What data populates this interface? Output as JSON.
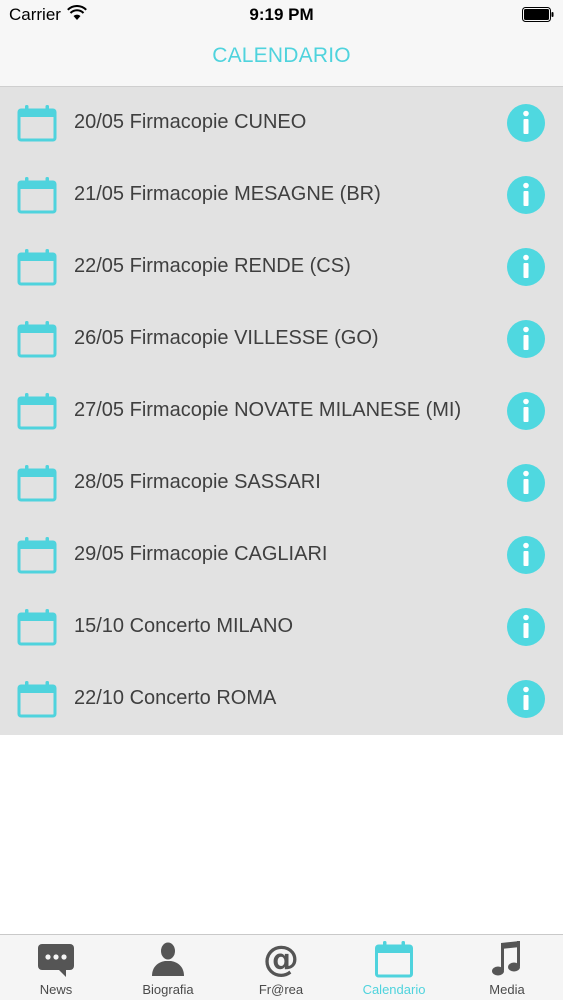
{
  "status_bar": {
    "carrier": "Carrier",
    "time": "9:19 PM"
  },
  "header": {
    "title": "CALENDARIO"
  },
  "events": [
    {
      "label": "20/05 Firmacopie CUNEO"
    },
    {
      "label": "21/05 Firmacopie MESAGNE (BR)"
    },
    {
      "label": "22/05 Firmacopie RENDE (CS)"
    },
    {
      "label": "26/05 Firmacopie VILLESSE (GO)"
    },
    {
      "label": "27/05 Firmacopie NOVATE MILANESE (MI)"
    },
    {
      "label": "28/05 Firmacopie SASSARI"
    },
    {
      "label": "29/05 Firmacopie CAGLIARI"
    },
    {
      "label": "15/10 Concerto MILANO"
    },
    {
      "label": "22/10 Concerto ROMA"
    }
  ],
  "tabs": [
    {
      "label": "News",
      "icon": "chat-bubble-icon"
    },
    {
      "label": "Biografia",
      "icon": "person-icon"
    },
    {
      "label": "Fr@rea",
      "icon": "at-sign-icon"
    },
    {
      "label": "Calendario",
      "icon": "calendar-icon",
      "active": true
    },
    {
      "label": "Media",
      "icon": "music-note-icon"
    }
  ],
  "colors": {
    "accent": "#4fd3dd",
    "list_background": "#e2e2e2",
    "tab_inactive_icon": "#555555"
  }
}
